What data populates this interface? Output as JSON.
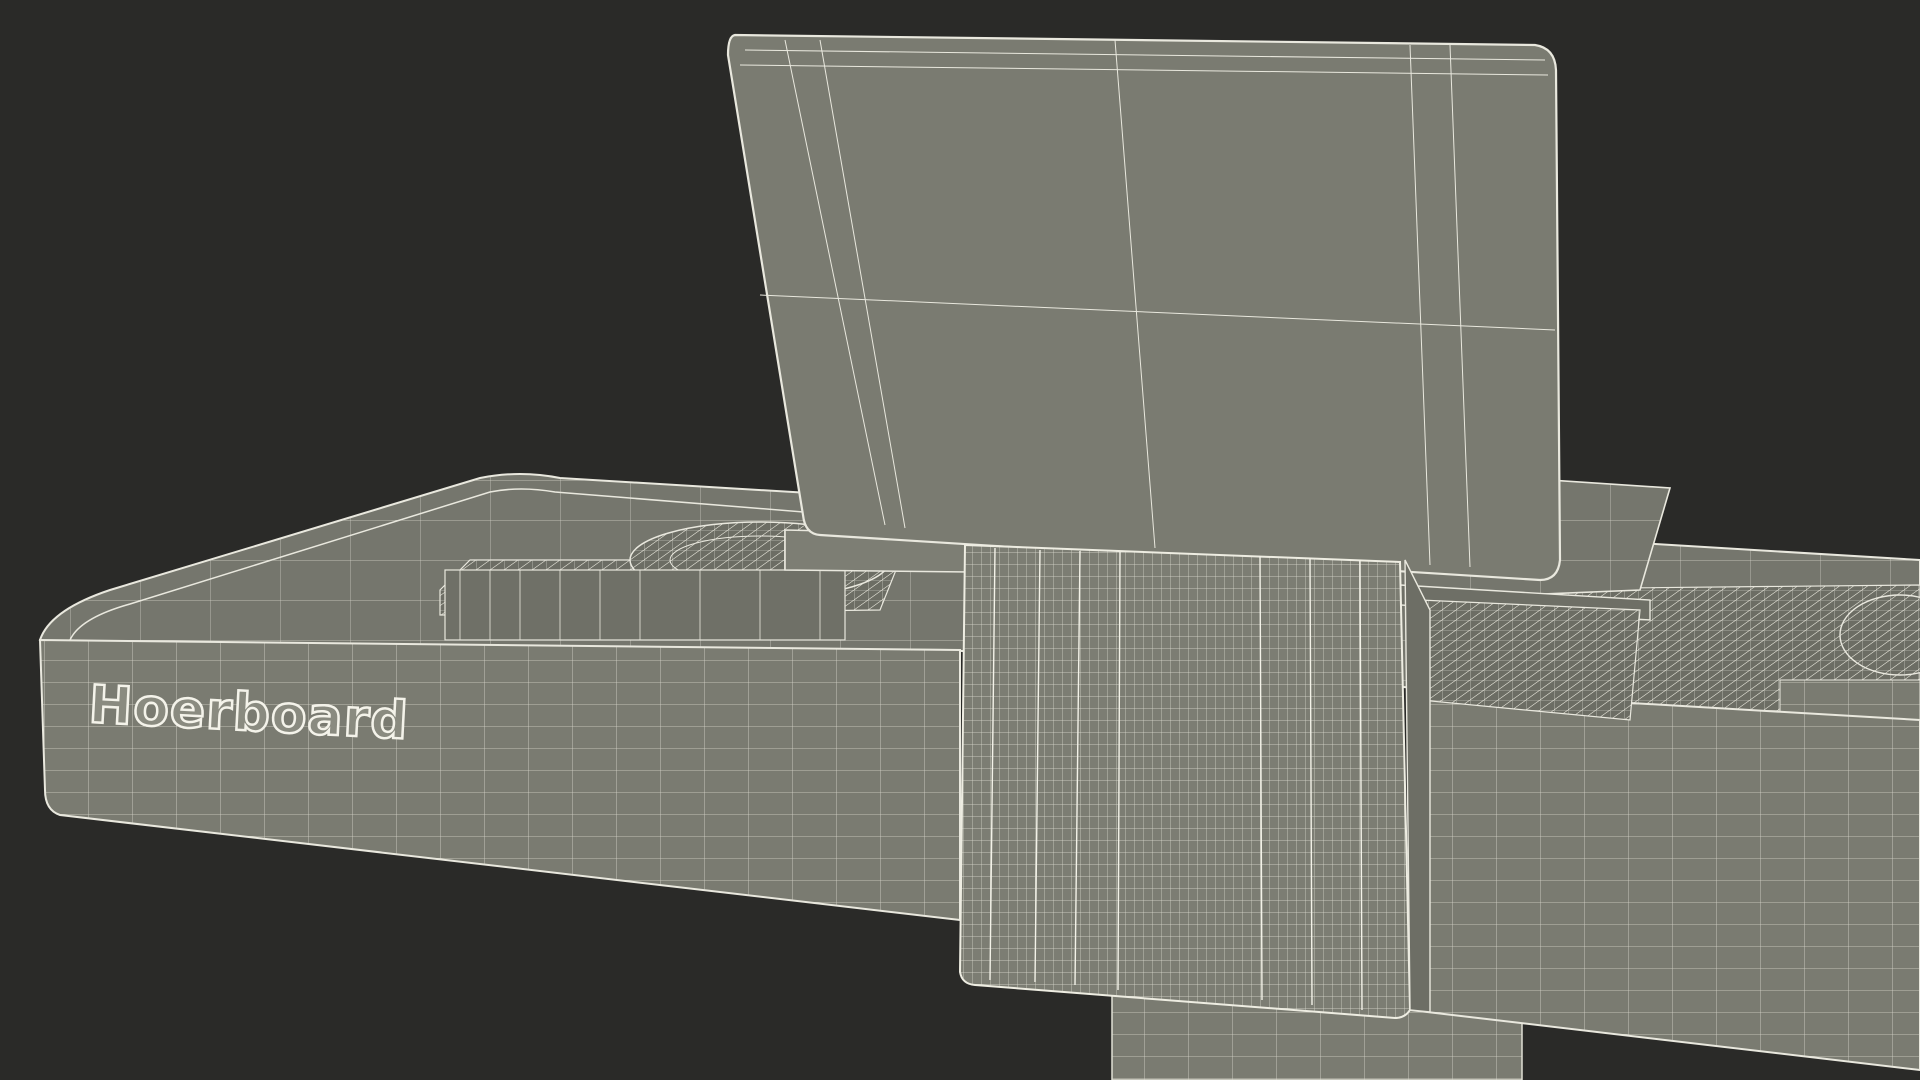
{
  "scene": {
    "description_type": "wireframe-render",
    "background_color": "#2a2a28",
    "surface_color": "#7b7c72",
    "wire_color": "#e9e8de",
    "shadow_color": "#55564f"
  },
  "branding": {
    "logo_text": "Hoerboard"
  }
}
